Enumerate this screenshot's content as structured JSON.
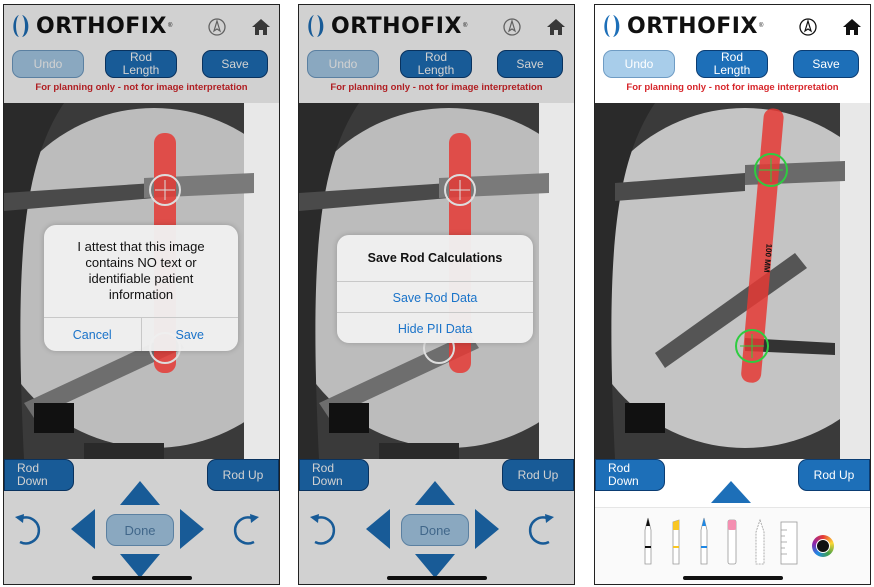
{
  "brand": {
    "name": "ORTHOFIX",
    "trademark": "®"
  },
  "colors": {
    "accent": "#1d6fb8",
    "warning": "#d7262b",
    "rod": "#e53935",
    "target_ring": "#2ecc40"
  },
  "icons": {
    "compass": "compass-icon",
    "home": "home-icon"
  },
  "toolbar": {
    "undo_label": "Undo",
    "rod_length_line1": "Rod",
    "rod_length_line2": "Length",
    "save_label": "Save"
  },
  "warning_text": "For planning only - not for image interpretation",
  "controls": {
    "rod_down_line1": "Rod",
    "rod_down_line2": "Down",
    "rod_up_label": "Rod Up",
    "done_label": "Done"
  },
  "attest_dialog": {
    "message": "I attest that this image contains NO text or identifiable patient information",
    "cancel_label": "Cancel",
    "save_label": "Save"
  },
  "save_dialog": {
    "title": "Save Rod Calculations",
    "save_rod_label": "Save Rod Data",
    "hide_pii_label": "Hide PII Data"
  },
  "rod_measurement": "100 MM",
  "markup_tools": [
    "pen",
    "marker",
    "pencil",
    "eraser",
    "lasso",
    "ruler",
    "color-picker"
  ]
}
